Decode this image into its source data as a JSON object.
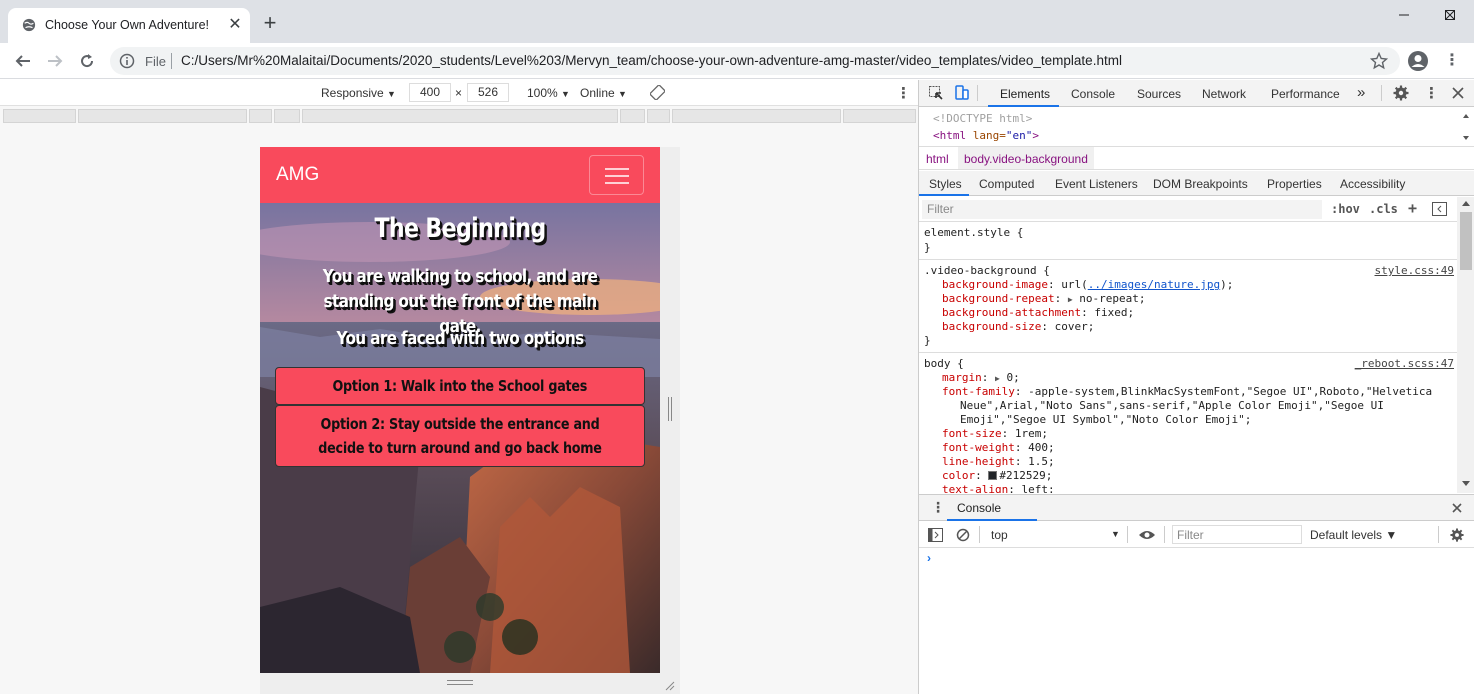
{
  "browser": {
    "tab_title": "Choose Your Own Adventure!",
    "tab_close": "✕",
    "new_tab": "+",
    "file_label": "File",
    "url": "C:/Users/Mr%20Malaitai/Documents/2020_students/Level%203/Mervyn_team/choose-your-own-adventure-amg-master/video_templates/video_template.html"
  },
  "device_toolbar": {
    "mode": "Responsive",
    "width": "400",
    "times": "×",
    "height": "526",
    "zoom": "100%",
    "network": "Online"
  },
  "page": {
    "brand": "AMG",
    "title": "The Beginning",
    "text": "You are walking to school, and are standing out the front of the main gate.",
    "subtext": "You are faced with two options",
    "option1": "Option 1: Walk into the School gates",
    "option2": "Option 2: Stay outside the entrance and decide to turn around and go back home"
  },
  "devtools": {
    "tabs": [
      "Elements",
      "Console",
      "Sources",
      "Network",
      "Performance"
    ],
    "more": "»",
    "dom": {
      "doctype": "<!DOCTYPE html>",
      "html_open": "<html",
      "lang_attr": " lang=",
      "lang_val": "\"en\"",
      "close": ">"
    },
    "breadcrumbs": [
      "html",
      "body.video-background"
    ],
    "subtabs": [
      "Styles",
      "Computed",
      "Event Listeners",
      "DOM Breakpoints",
      "Properties",
      "Accessibility"
    ],
    "filter_placeholder": "Filter",
    "hov": ":hov",
    "cls": ".cls",
    "plus": "+",
    "rules": {
      "element_style": "element.style {",
      "close_brace": "}",
      "vb_selector": ".video-background {",
      "vb_source": "style.css:49",
      "vb_props": [
        {
          "name": "background-image",
          "value_pre": "url(",
          "value_link": "../images/nature.jpg",
          "value_post": ");"
        },
        {
          "name": "background-repeat",
          "value": "no-repeat;"
        },
        {
          "name": "background-attachment",
          "value": "fixed;"
        },
        {
          "name": "background-size",
          "value": "cover;"
        }
      ],
      "body_selector": "body {",
      "body_source": "_reboot.scss:47",
      "body_props": [
        {
          "name": "margin",
          "value": "0;"
        },
        {
          "name": "font-family",
          "value": "-apple-system,BlinkMacSystemFont,\"Segoe UI\",Roboto,\"Helvetica"
        },
        {
          "name": "",
          "value": "Neue\",Arial,\"Noto Sans\",sans-serif,\"Apple Color Emoji\",\"Segoe UI"
        },
        {
          "name": "",
          "value": "Emoji\",\"Segoe UI Symbol\",\"Noto Color Emoji\";"
        },
        {
          "name": "font-size",
          "value": "1rem;"
        },
        {
          "name": "font-weight",
          "value": "400;"
        },
        {
          "name": "line-height",
          "value": "1.5;"
        },
        {
          "name": "color",
          "value": "#212529;"
        },
        {
          "name": "text-align",
          "value": "left;"
        }
      ]
    },
    "drawer": {
      "tab": "Console",
      "context": "top",
      "filter_placeholder": "Filter",
      "levels": "Default levels ▼",
      "prompt": "›"
    }
  },
  "colors": {
    "accent": "#f94a5c",
    "devtools_blue": "#1a73e8"
  }
}
